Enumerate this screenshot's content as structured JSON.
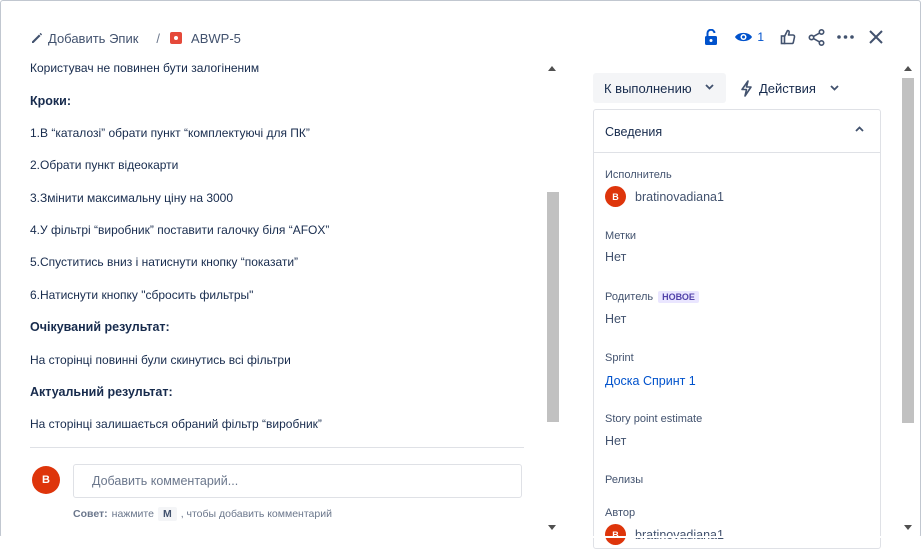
{
  "header": {
    "add_epic": "Добавить Эпик",
    "separator": "/",
    "issue_key": "ABWP-5",
    "watch_count": "1",
    "icons": [
      "pencil-icon",
      "bug-icon",
      "lock-icon",
      "eye-icon",
      "thumbs-up-icon",
      "share-icon",
      "more-icon",
      "close-icon"
    ]
  },
  "description": {
    "intro": "Користувач не повинен бути залогіненим",
    "steps_heading": "Кроки:",
    "steps": [
      "1.В “каталозі” обрати пункт “комплектуючі для ПК”",
      "2.Обрати пункт відеокарти",
      "3.Змінити максимальну ціну на 3000",
      "4.У фільтрі “виробник” поставити галочку біля “AFOX”",
      "5.Спуститись вниз і натиснути кнопку “показати”",
      "6.Натиснути кнопку \"сбросить фильтры\""
    ],
    "expected_heading": "Очікуваний результат:",
    "expected": "На сторінці повинні були скинутись всі фільтри",
    "actual_heading": "Актуальний результат:",
    "actual": "На сторінці залишається обраний фільтр “виробник”"
  },
  "comment": {
    "avatar_letter": "B",
    "placeholder": "Добавить комментарий...",
    "tip_label": "Совет:",
    "tip_before": "нажмите",
    "tip_key": "M",
    "tip_after": ", чтобы добавить комментарий"
  },
  "status": {
    "label": "К выполнению",
    "actions_label": "Действия"
  },
  "details": {
    "title": "Сведения",
    "assignee_label": "Исполнитель",
    "assignee_avatar": "B",
    "assignee_name": "bratinovadiana1",
    "labels_label": "Метки",
    "labels_value": "Нет",
    "parent_label": "Родитель",
    "parent_badge": "НОВОЕ",
    "parent_value": "Нет",
    "sprint_label": "Sprint",
    "sprint_value": "Доска Спринт 1",
    "story_points_label": "Story point estimate",
    "story_points_value": "Нет",
    "releases_label": "Релизы",
    "author_label": "Автор",
    "author_avatar": "B",
    "author_name": "bratinovadiana1"
  },
  "colors": {
    "accent": "#0052cc",
    "avatar": "#de350b",
    "bug": "#e5493a",
    "badge_bg": "#eae6ff",
    "badge_text": "#5243aa"
  }
}
